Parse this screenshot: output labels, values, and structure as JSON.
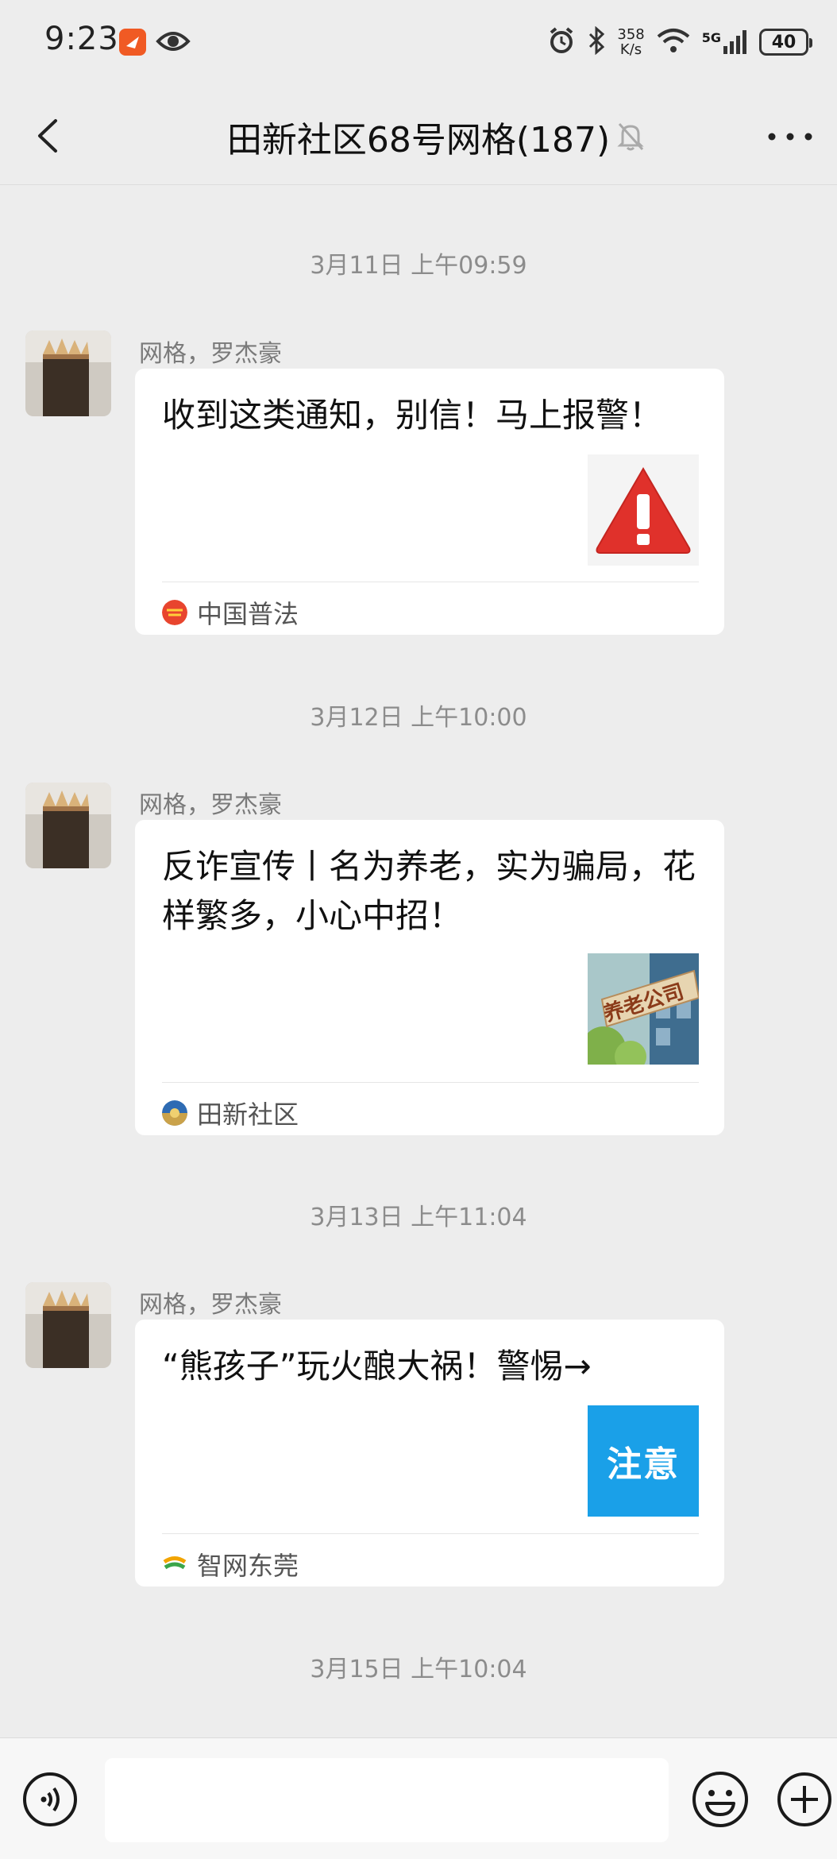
{
  "status_bar": {
    "time": "9:23",
    "net_speed_value": "358",
    "net_speed_unit": "K/s",
    "network": "5G",
    "battery": "40"
  },
  "header": {
    "title": "田新社区68号网格(187)"
  },
  "messages": [
    {
      "timestamp": "3月11日 上午09:59",
      "sender": "网格，罗杰豪",
      "title": "收到这类通知，别信！马上报警！",
      "thumb_icon": "warning-triangle-icon",
      "source": "中国普法"
    },
    {
      "timestamp": "3月12日 上午10:00",
      "sender": "网格，罗杰豪",
      "title": "反诈宣传丨名为养老，实为骗局，花样繁多，小心中招！",
      "thumb_text": "养老公司",
      "source": "田新社区"
    },
    {
      "timestamp": "3月13日 上午11:04",
      "sender": "网格，罗杰豪",
      "title": "“熊孩子”玩火酿大祸！警惕→",
      "thumb_text": "注意",
      "source": "智网东莞"
    }
  ],
  "trailing_timestamp": "3月15日 上午10:04",
  "input": {
    "value": "",
    "placeholder": ""
  },
  "colors": {
    "background": "#ededed",
    "card": "#ffffff",
    "warning_red": "#e0312b",
    "notice_blue": "#1aa0e8",
    "app_orange": "#f05a24"
  }
}
